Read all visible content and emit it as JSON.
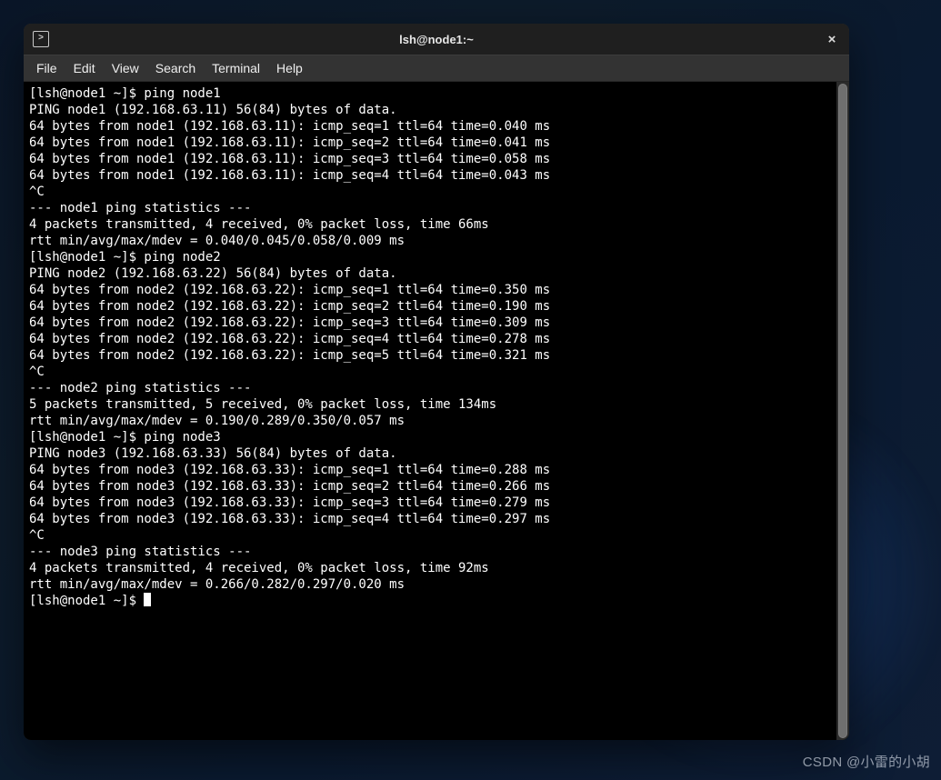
{
  "window": {
    "title": "lsh@node1:~"
  },
  "menubar": {
    "items": [
      "File",
      "Edit",
      "View",
      "Search",
      "Terminal",
      "Help"
    ]
  },
  "terminal": {
    "prompt": "[lsh@node1 ~]$ ",
    "lines": [
      "[lsh@node1 ~]$ ping node1",
      "PING node1 (192.168.63.11) 56(84) bytes of data.",
      "64 bytes from node1 (192.168.63.11): icmp_seq=1 ttl=64 time=0.040 ms",
      "64 bytes from node1 (192.168.63.11): icmp_seq=2 ttl=64 time=0.041 ms",
      "64 bytes from node1 (192.168.63.11): icmp_seq=3 ttl=64 time=0.058 ms",
      "64 bytes from node1 (192.168.63.11): icmp_seq=4 ttl=64 time=0.043 ms",
      "^C",
      "--- node1 ping statistics ---",
      "4 packets transmitted, 4 received, 0% packet loss, time 66ms",
      "rtt min/avg/max/mdev = 0.040/0.045/0.058/0.009 ms",
      "[lsh@node1 ~]$ ping node2",
      "PING node2 (192.168.63.22) 56(84) bytes of data.",
      "64 bytes from node2 (192.168.63.22): icmp_seq=1 ttl=64 time=0.350 ms",
      "64 bytes from node2 (192.168.63.22): icmp_seq=2 ttl=64 time=0.190 ms",
      "64 bytes from node2 (192.168.63.22): icmp_seq=3 ttl=64 time=0.309 ms",
      "64 bytes from node2 (192.168.63.22): icmp_seq=4 ttl=64 time=0.278 ms",
      "64 bytes from node2 (192.168.63.22): icmp_seq=5 ttl=64 time=0.321 ms",
      "^C",
      "--- node2 ping statistics ---",
      "5 packets transmitted, 5 received, 0% packet loss, time 134ms",
      "rtt min/avg/max/mdev = 0.190/0.289/0.350/0.057 ms",
      "[lsh@node1 ~]$ ping node3",
      "PING node3 (192.168.63.33) 56(84) bytes of data.",
      "64 bytes from node3 (192.168.63.33): icmp_seq=1 ttl=64 time=0.288 ms",
      "64 bytes from node3 (192.168.63.33): icmp_seq=2 ttl=64 time=0.266 ms",
      "64 bytes from node3 (192.168.63.33): icmp_seq=3 ttl=64 time=0.279 ms",
      "64 bytes from node3 (192.168.63.33): icmp_seq=4 ttl=64 time=0.297 ms",
      "^C",
      "--- node3 ping statistics ---",
      "4 packets transmitted, 4 received, 0% packet loss, time 92ms",
      "rtt min/avg/max/mdev = 0.266/0.282/0.297/0.020 ms"
    ],
    "final_prompt": "[lsh@node1 ~]$ "
  },
  "watermark": "CSDN @小雷的小胡"
}
